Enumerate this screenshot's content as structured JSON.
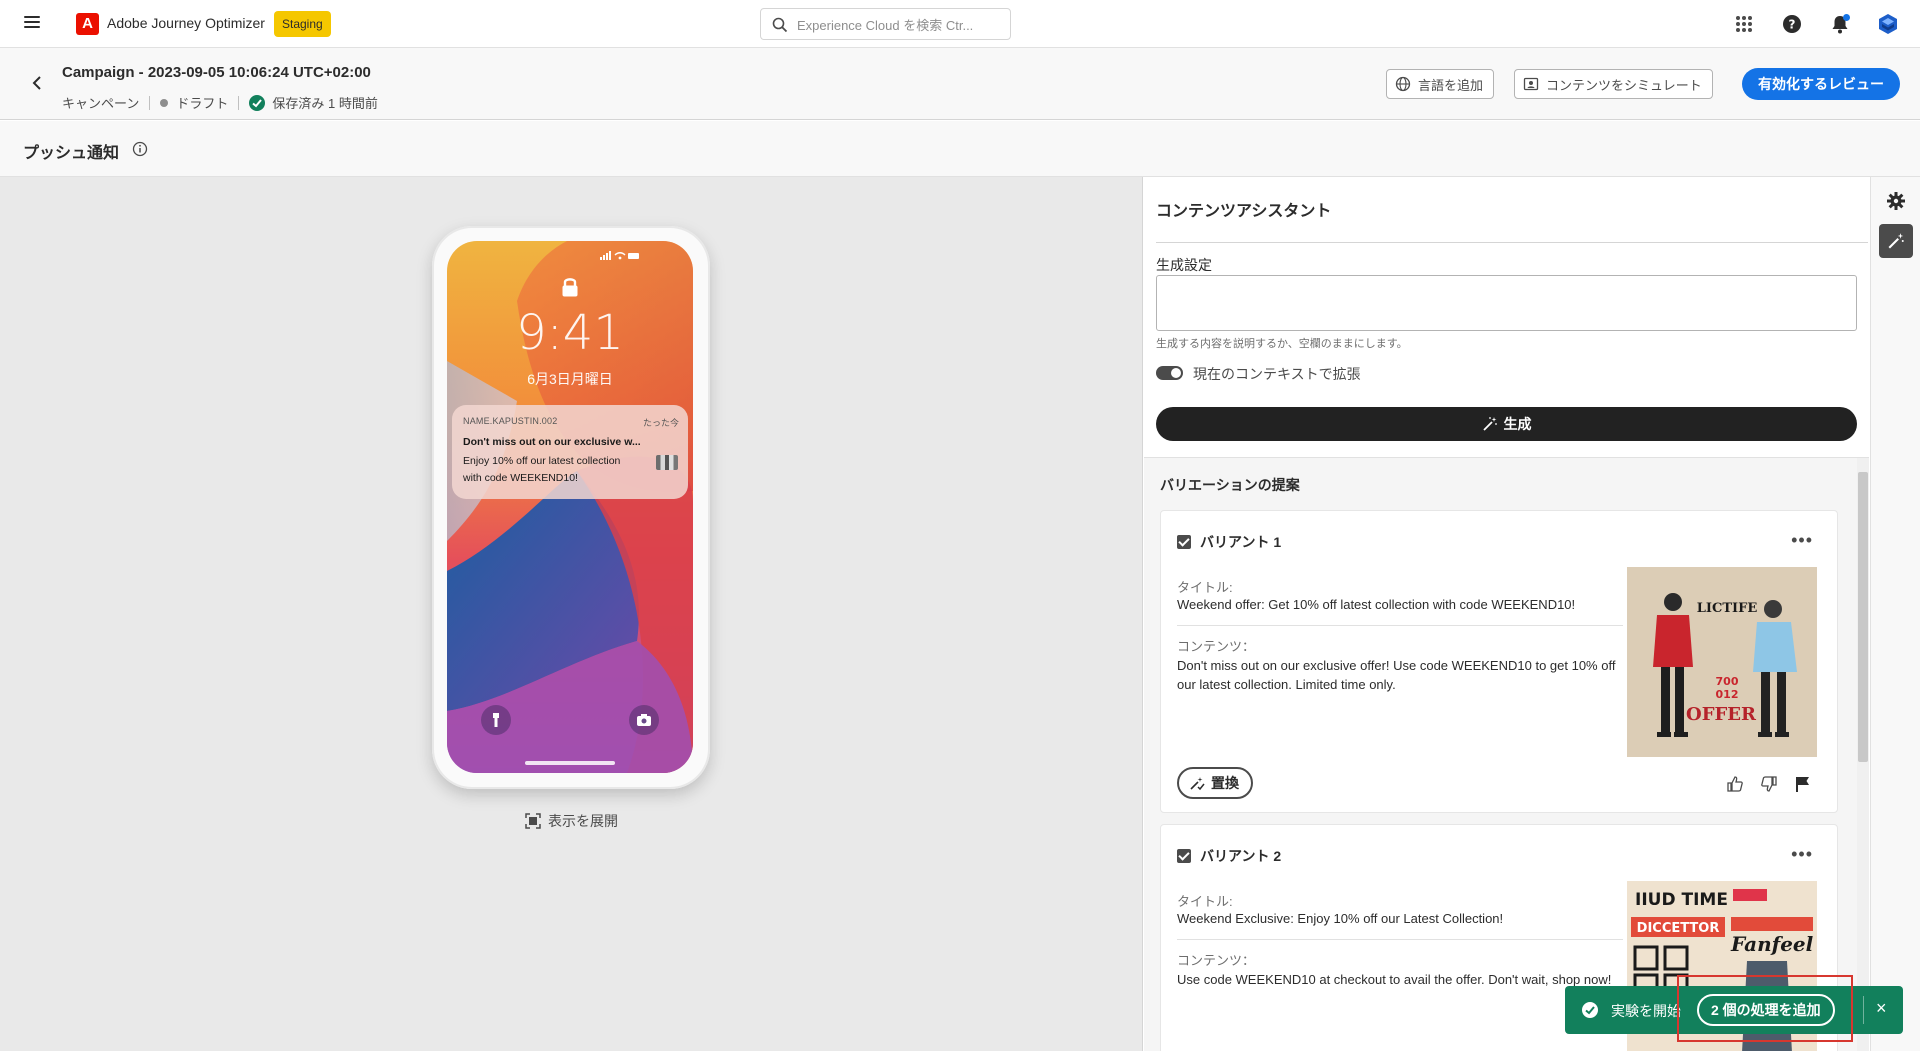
{
  "topbar": {
    "app_name": "Adobe Journey Optimizer",
    "env_badge": "Staging",
    "search_placeholder": "Experience Cloud を検索 Ctr..."
  },
  "header": {
    "title": "Campaign - 2023-09-05 10:06:24 UTC+02:00",
    "type": "キャンペーン",
    "status": "ドラフト",
    "saved": "保存済み 1 時間前",
    "add_language": "言語を追加",
    "simulate_content": "コンテンツをシミュレート",
    "review_activate": "有効化するレビュー"
  },
  "section": {
    "title": "プッシュ通知"
  },
  "preview": {
    "clock": "9:41",
    "date": "6月3日月曜日",
    "notification": {
      "app": "NAME.KAPUSTIN.002",
      "time": "たった今",
      "title": "Don't miss out on our exclusive w...",
      "body": "Enjoy 10% off our latest collection with code WEEKEND10!"
    },
    "expand_label": "表示を展開"
  },
  "assistant": {
    "title": "コンテンツアシスタント",
    "gen_label": "生成設定",
    "gen_value": "",
    "gen_help": "生成する内容を説明するか、空欄のままにします。",
    "toggle_label": "現在のコンテキストで拡張",
    "toggle_on": true,
    "generate_button": "生成",
    "variations_heading": "バリエーションの提案",
    "replace_label": "置換",
    "variants": [
      {
        "name": "バリアント 1",
        "title_label": "タイトル:",
        "title": "Weekend offer: Get 10% off latest collection with code WEEKEND10!",
        "content_label": "コンテンツ：",
        "content": "Don't miss out on our exclusive offer! Use code WEEKEND10 to get 10% off our latest collection. Limited time only.",
        "image_text": [
          "LICTIFE",
          "OFFER"
        ],
        "image_numbers": [
          "700",
          "012"
        ],
        "checked": true
      },
      {
        "name": "バリアント 2",
        "title_label": "タイトル:",
        "title": "Weekend Exclusive: Enjoy 10% off our Latest Collection!",
        "content_label": "コンテンツ：",
        "content": "Use code WEEKEND10 at checkout to avail the offer. Don't wait, shop now!",
        "image_text": [
          "IIUD TIME",
          "DICCETTOR",
          "Fanfeel"
        ],
        "checked": true
      }
    ]
  },
  "toast": {
    "message": "実験を開始",
    "action": "2 個の処理を追加",
    "close": "×"
  },
  "colors": {
    "primary": "#1473e6",
    "toast": "#12805c",
    "staging": "#f5c700",
    "adobe_red": "#eb1000"
  }
}
